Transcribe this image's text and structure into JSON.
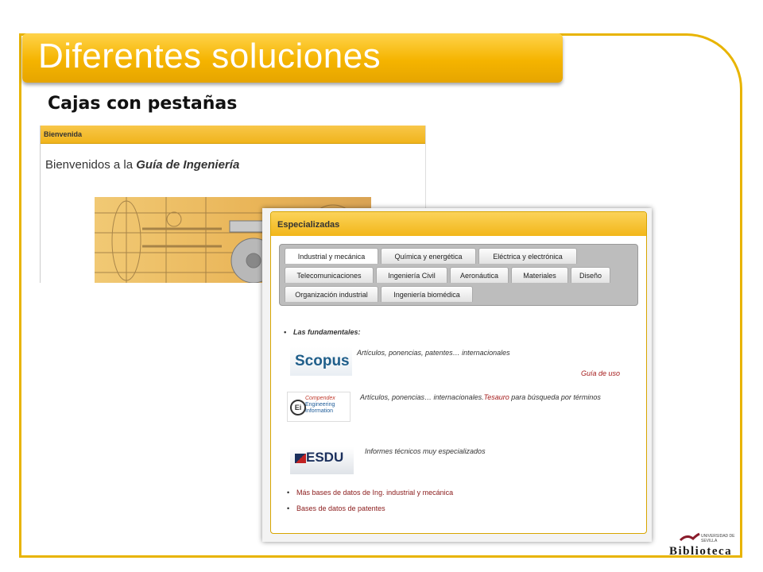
{
  "slide": {
    "title": "Diferentes soluciones",
    "subtitle": "Cajas con pestañas"
  },
  "panel1": {
    "header": "Bienvenida",
    "welcome_prefix": "Bienvenidos a la ",
    "welcome_emph": "Guía de Ingeniería"
  },
  "panel2": {
    "header": "Especializadas",
    "tabs_row1": [
      "Industrial y mecánica",
      "Química y energética",
      "Eléctrica y electrónica"
    ],
    "tabs_row2": [
      "Telecomunicaciones",
      "Ingeniería Civil",
      "Aeronáutica",
      "Materiales",
      "Diseño"
    ],
    "tabs_row3": [
      "Organización industrial",
      "Ingeniería biomédica"
    ],
    "active_tab": "Industrial y mecánica",
    "section_title": "Las fundamentales:",
    "resources": [
      {
        "logo": "Scopus",
        "desc": "Artículos, ponencias, patentes… internacionales",
        "extra": "Guía de uso"
      },
      {
        "logo_lines": [
          "Compendex",
          "Engineering",
          "Information"
        ],
        "logo_mark": "Ei",
        "desc": "Artículos, ponencias… internacionales.",
        "desc_link": "Tesauro",
        "desc_tail": " para búsqueda por términos"
      },
      {
        "logo": "ESDU",
        "desc": "Informes técnicos muy especializados"
      }
    ],
    "links": [
      "Más bases de datos de Ing. industrial y mecánica",
      "Bases de datos de patentes"
    ]
  },
  "footer": {
    "brand": "Biblioteca",
    "brand_small": "UNIVERSIDAD DE SEVILLA"
  },
  "colors": {
    "accent": "#f5b400",
    "frame": "#e8b400",
    "link": "#a51c1c"
  }
}
